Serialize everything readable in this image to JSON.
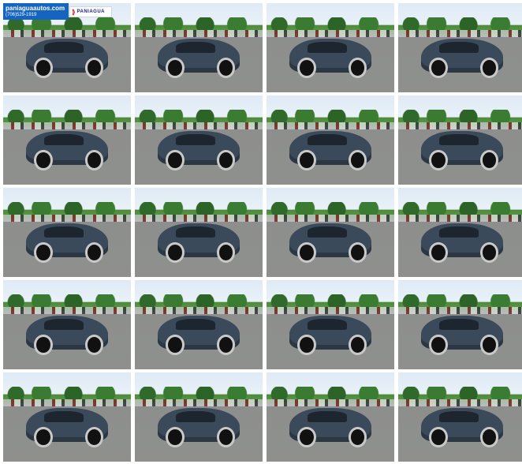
{
  "dealer": {
    "website": "paniaguaautos.com",
    "phone": "(706)529-1919",
    "logo_text": "PANIAGUA"
  },
  "gallery": {
    "photos": [
      {
        "view": "front-left"
      },
      {
        "view": "left-side"
      },
      {
        "view": "rear-left"
      },
      {
        "view": "rear"
      },
      {
        "view": "rear-left"
      },
      {
        "view": "left-side"
      },
      {
        "view": "front-right"
      },
      {
        "view": "front"
      },
      {
        "view": "front-left"
      },
      {
        "view": "left-side"
      },
      {
        "view": "rear-left"
      },
      {
        "view": "front-right"
      },
      {
        "view": "left-side"
      },
      {
        "view": "rear-right"
      },
      {
        "view": "rear"
      },
      {
        "view": "rear-right"
      },
      {
        "view": "left-side"
      },
      {
        "view": "front-left"
      },
      {
        "view": "front"
      },
      {
        "view": "front-right"
      }
    ]
  }
}
